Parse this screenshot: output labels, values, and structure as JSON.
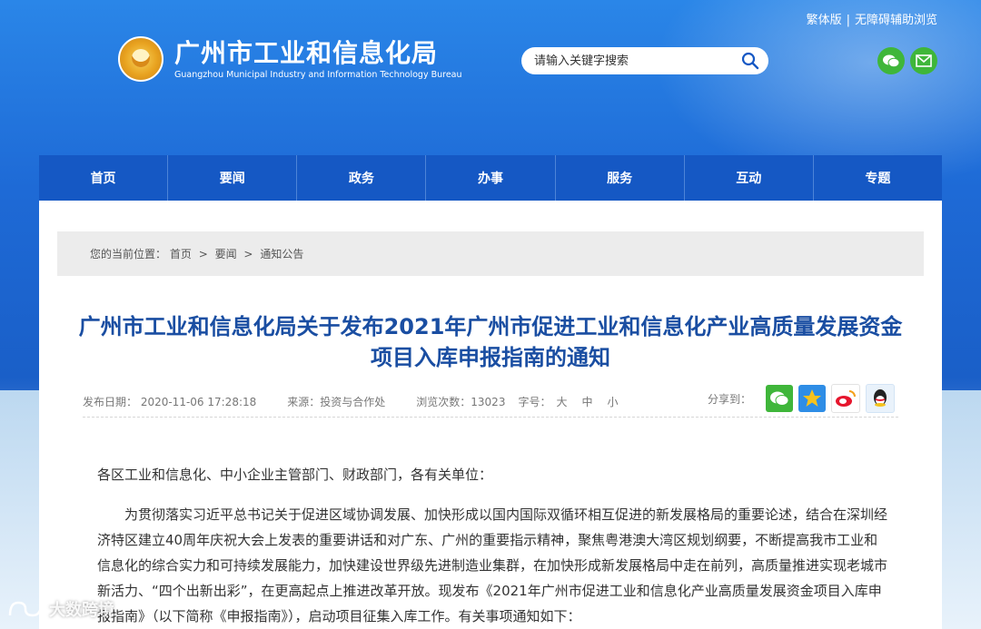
{
  "top_links": {
    "traditional": "繁体版",
    "separator": "|",
    "accessibility": "无障碍辅助浏览"
  },
  "logo": {
    "name_cn": "广州市工业和信息化局",
    "name_en": "Guangzhou Municipal Industry and Information Technology Bureau"
  },
  "search": {
    "placeholder": "请输入关键字搜索"
  },
  "nav": {
    "items": [
      "首页",
      "要闻",
      "政务",
      "办事",
      "服务",
      "互动",
      "专题"
    ]
  },
  "breadcrumb": {
    "prefix": "您的当前位置：",
    "items": [
      "首页",
      "要闻",
      "通知公告"
    ],
    "arrow": ">"
  },
  "article": {
    "title": "广州市工业和信息化局关于发布2021年广州市促进工业和信息化产业高质量发展资金项目入库申报指南的通知",
    "publish_date": "发布日期： 2020-11-06 17:28:18",
    "source": "来源：投资与合作处",
    "views": "浏览次数：13023",
    "font_label": "字号：",
    "font_sizes": [
      "大",
      "中",
      "小"
    ],
    "share_label": "分享到：",
    "salutation": "各区工业和信息化、中小企业主管部门、财政部门，各有关单位：",
    "paragraph": "为贯彻落实习近平总书记关于促进区域协调发展、加快形成以国内国际双循环相互促进的新发展格局的重要论述，结合在深圳经济特区建立40周年庆祝大会上发表的重要讲话和对广东、广州的重要指示精神，聚焦粤港澳大湾区规划纲要，不断提高我市工业和信息化的综合实力和可持续发展能力，加快建设世界级先进制造业集群，在加快形成新发展格局中走在前列，高质量推进实现老城市新活力、“四个出新出彩”，在更高起点上推进改革开放。现发布《2021年广州市促进工业和信息化产业高质量发展资金项目入库申报指南》（以下简称《申报指南》），启动项目征集入库工作。有关事项通知如下："
  },
  "watermark": "大数跨境",
  "colors": {
    "nav": "#1558c4",
    "title": "#1a4ea2",
    "wechat_green": "#3fb63a"
  }
}
